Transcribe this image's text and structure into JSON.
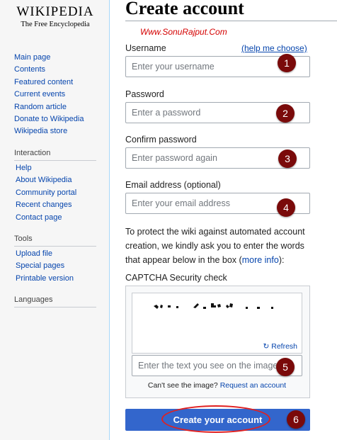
{
  "logo": {
    "wordmark": "WIKIPEDIA",
    "tagline": "The Free Encyclopedia"
  },
  "sidebar": {
    "main_links": [
      "Main page",
      "Contents",
      "Featured content",
      "Current events",
      "Random article",
      "Donate to Wikipedia",
      "Wikipedia store"
    ],
    "interaction": {
      "heading": "Interaction",
      "links": [
        "Help",
        "About Wikipedia",
        "Community portal",
        "Recent changes",
        "Contact page"
      ]
    },
    "tools": {
      "heading": "Tools",
      "links": [
        "Upload file",
        "Special pages",
        "Printable version"
      ]
    },
    "languages": {
      "heading": "Languages"
    }
  },
  "page": {
    "title": "Create account",
    "watermark": "Www.SonuRajput.Com"
  },
  "form": {
    "username": {
      "label": "Username",
      "help": "(help me choose)",
      "placeholder": "Enter your username",
      "value": ""
    },
    "password": {
      "label": "Password",
      "placeholder": "Enter a password",
      "value": ""
    },
    "confirm": {
      "label": "Confirm password",
      "placeholder": "Enter password again",
      "value": ""
    },
    "email": {
      "label": "Email address (optional)",
      "placeholder": "Enter your email address",
      "value": ""
    },
    "captcha_intro": "To protect the wiki against automated account creation, we kindly ask you to enter the words that appear below in the box (",
    "captcha_more": "more info",
    "captcha_intro_end": "):",
    "captcha_label": "CAPTCHA Security check",
    "captcha": {
      "refresh": "Refresh",
      "placeholder": "Enter the text you see on the image",
      "cant_see": "Can't see the image?",
      "request": "Request an account"
    },
    "submit": "Create your account"
  },
  "markers": [
    "1",
    "2",
    "3",
    "4",
    "5",
    "6"
  ],
  "colors": {
    "link": "#0645ad",
    "button": "#3366cc",
    "marker": "#7a0a0a",
    "highlight_ring": "#e02020",
    "watermark": "#d40000"
  }
}
